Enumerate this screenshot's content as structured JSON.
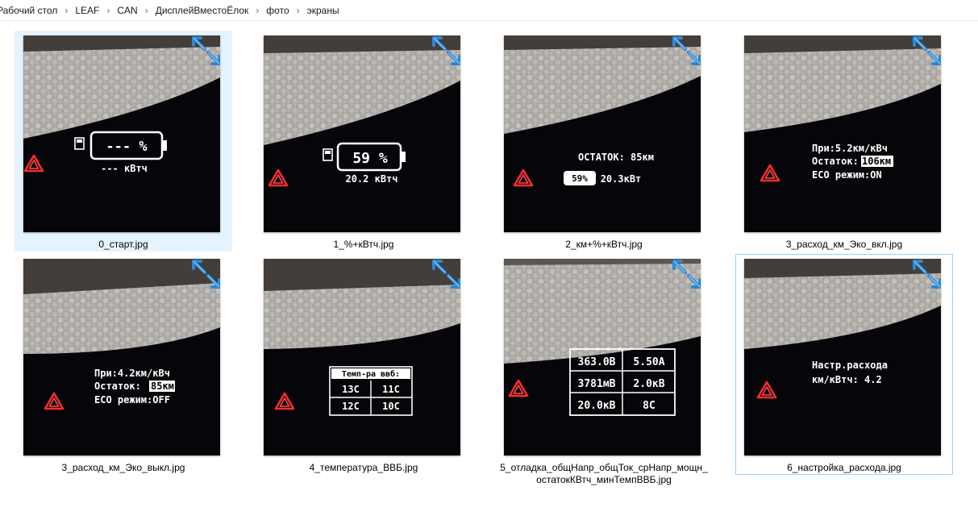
{
  "breadcrumb": [
    "Рабочий стол",
    "LEAF",
    "CAN",
    "ДисплейВместоЁлок",
    "фото",
    "экраны"
  ],
  "files": [
    {
      "name": "0_старт.jpg",
      "screen": {
        "battery": "--- %",
        "energy": "--- кВтч"
      }
    },
    {
      "name": "1_%+кВтч.jpg",
      "screen": {
        "battery": "59 %",
        "energy": "20.2 кВтч"
      }
    },
    {
      "name": "2_км+%+кВтч.jpg",
      "screen": {
        "line1": "ОСТАТОК: 85км",
        "pct": "59%",
        "energy": "20.3кВт"
      }
    },
    {
      "name": "3_расход_км_Эко_вкл.jpg",
      "screen": {
        "line1": "При:5.2км/кВч",
        "line2_label": "Остаток:",
        "line2_value": "106км",
        "line3": "ECO режим:ON"
      }
    },
    {
      "name": "3_расход_км_Эко_выкл.jpg",
      "screen": {
        "line1": "При:4.2км/кВч",
        "line2_label": "Остаток:",
        "line2_value": "85км",
        "line3": "ECO режим:OFF"
      }
    },
    {
      "name": "4_температура_ВВБ.jpg",
      "screen": {
        "header": "Темп-ра ввб:",
        "cells": [
          "13C",
          "11C",
          "12C",
          "10C"
        ]
      }
    },
    {
      "name_line1": "5_отладка_общНапр_общТок_срНапр_мощн_",
      "name_line2": "остатокКВтч_минТемпВВБ.jpg",
      "screen": {
        "cells": [
          "363.0В",
          "5.50А",
          "3781мВ",
          "2.0кВ",
          "20.0кВ",
          "8C"
        ]
      }
    },
    {
      "name": "6_настройка_расхода.jpg",
      "screen": {
        "line1": "Настр.расхода",
        "line2": "км/кВтч: 4.2"
      }
    }
  ],
  "icons": {
    "sync": "sync-pending-icon",
    "warning": "hazard-warning-icon",
    "fuel": "fuel-pump-icon",
    "battery": "battery-icon"
  },
  "colors": {
    "selection": "#e5f3ff",
    "focus_border": "#99d1ff",
    "sync_icon": "#2b88d8"
  }
}
